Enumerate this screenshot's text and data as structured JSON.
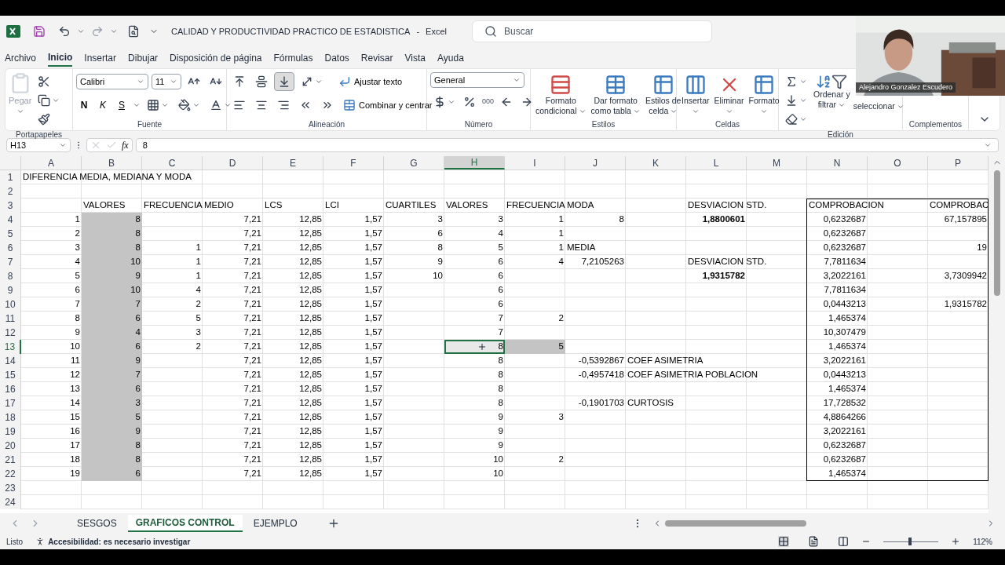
{
  "title_bar": {
    "title": "CALIDAD Y PRODUCTIVIDAD PRACTICO DE ESTADISTICA",
    "app": "Excel",
    "separator": "-",
    "search_placeholder": "Buscar"
  },
  "menu_tabs": [
    {
      "label": "Archivo",
      "selected": false
    },
    {
      "label": "Inicio",
      "selected": true
    },
    {
      "label": "Insertar",
      "selected": false
    },
    {
      "label": "Dibujar",
      "selected": false
    },
    {
      "label": "Disposición de página",
      "selected": false
    },
    {
      "label": "Fórmulas",
      "selected": false
    },
    {
      "label": "Datos",
      "selected": false
    },
    {
      "label": "Revisar",
      "selected": false
    },
    {
      "label": "Vista",
      "selected": false
    },
    {
      "label": "Ayuda",
      "selected": false
    }
  ],
  "ribbon": {
    "clipboard": {
      "label": "Portapapeles",
      "paste": {
        "label": "Pegar",
        "disabled": true
      }
    },
    "font": {
      "label": "Fuente",
      "font_name": "Calibri",
      "font_size": "11",
      "bold": "N",
      "italic": "K",
      "underline": "S"
    },
    "alignment": {
      "label": "Alineación",
      "wrap_text": "Ajustar texto",
      "merge_center": "Combinar y centrar",
      "bottom_align_on": true
    },
    "number": {
      "label": "Número",
      "format": "General",
      "thousands": "000"
    },
    "styles": {
      "label": "Estilos",
      "buttons": [
        {
          "lines": [
            "Formato",
            "condicional"
          ]
        },
        {
          "lines": [
            "Dar formato",
            "como tabla"
          ]
        },
        {
          "lines": [
            "Estilos de",
            "celda"
          ]
        }
      ]
    },
    "cells": {
      "label": "Celdas",
      "buttons": [
        {
          "lines": [
            "Insertar"
          ]
        },
        {
          "lines": [
            "Eliminar"
          ]
        },
        {
          "lines": [
            "Formato"
          ]
        }
      ]
    },
    "editing": {
      "label": "Edición",
      "buttons": [
        {
          "lines": [
            "Ordenar y",
            "filtrar"
          ]
        },
        {
          "lines": [
            "seleccionar"
          ]
        }
      ]
    },
    "addins": {
      "label": "Complementos"
    }
  },
  "formula_bar": {
    "name_box": "H13",
    "function_label": "fx",
    "formula": "8"
  },
  "sheet": {
    "columns": [
      "A",
      "B",
      "C",
      "D",
      "E",
      "F",
      "G",
      "H",
      "I",
      "J",
      "K",
      "L",
      "M",
      "N",
      "O",
      "P"
    ],
    "rows": [
      {
        "number": "1",
        "cells": [
          {
            "text": "DIFERENCIA MEDIA, MEDIANA Y MODA",
            "kind": "text"
          }
        ]
      },
      {
        "number": "2",
        "cells": []
      },
      {
        "number": "3",
        "cells": [
          "",
          {
            "text": "VALORES",
            "kind": "text"
          },
          {
            "text": "FRECUENCIA",
            "kind": "text"
          },
          {
            "text": "MEDIO",
            "kind": "text"
          },
          {
            "text": "LCS",
            "kind": "text"
          },
          {
            "text": "LCI",
            "kind": "text"
          },
          {
            "text": "CUARTILES",
            "kind": "text"
          },
          {
            "text": "VALORES",
            "kind": "text"
          },
          {
            "text": "FRECUENCIA",
            "kind": "text"
          },
          {
            "text": "MODA",
            "kind": "text"
          },
          "",
          {
            "text": "DESVIACION STD.",
            "kind": "text"
          },
          "",
          {
            "text": "COMPROBACION",
            "kind": "text"
          },
          "",
          {
            "text": "COMPROBAC",
            "kind": "text"
          }
        ]
      },
      {
        "number": "4",
        "cells": [
          {
            "text": "1",
            "kind": "number"
          },
          {
            "text": "8",
            "kind": "shaded_number"
          },
          "",
          {
            "text": "7,21",
            "kind": "number"
          },
          {
            "text": "12,85",
            "kind": "number"
          },
          {
            "text": "1,57",
            "kind": "number"
          },
          {
            "text": "3",
            "kind": "number"
          },
          {
            "text": "3",
            "kind": "number"
          },
          {
            "text": "1",
            "kind": "number"
          },
          {
            "text": "8",
            "kind": "number"
          },
          "",
          {
            "text": "1,8800601",
            "kind": "bold_number"
          },
          "",
          {
            "text": "0,6232687",
            "kind": "number"
          },
          "",
          {
            "text": "67,157895",
            "kind": "number"
          }
        ]
      },
      {
        "number": "5",
        "cells": [
          {
            "text": "2",
            "kind": "number"
          },
          {
            "text": "8",
            "kind": "shaded_number"
          },
          "",
          {
            "text": "7,21",
            "kind": "number"
          },
          {
            "text": "12,85",
            "kind": "number"
          },
          {
            "text": "1,57",
            "kind": "number"
          },
          {
            "text": "6",
            "kind": "number"
          },
          {
            "text": "4",
            "kind": "number"
          },
          {
            "text": "1",
            "kind": "number"
          },
          "",
          "",
          "",
          "",
          {
            "text": "0,6232687",
            "kind": "number"
          }
        ]
      },
      {
        "number": "6",
        "cells": [
          {
            "text": "3",
            "kind": "number"
          },
          {
            "text": "8",
            "kind": "shaded_number"
          },
          {
            "text": "1",
            "kind": "number"
          },
          {
            "text": "7,21",
            "kind": "number"
          },
          {
            "text": "12,85",
            "kind": "number"
          },
          {
            "text": "1,57",
            "kind": "number"
          },
          {
            "text": "8",
            "kind": "number"
          },
          {
            "text": "5",
            "kind": "number"
          },
          {
            "text": "1",
            "kind": "number"
          },
          {
            "text": "MEDIA",
            "kind": "text"
          },
          "",
          "",
          "",
          {
            "text": "0,6232687",
            "kind": "number"
          },
          "",
          {
            "text": "19",
            "kind": "number"
          }
        ]
      },
      {
        "number": "7",
        "cells": [
          {
            "text": "4",
            "kind": "number"
          },
          {
            "text": "10",
            "kind": "shaded_number"
          },
          {
            "text": "1",
            "kind": "number"
          },
          {
            "text": "7,21",
            "kind": "number"
          },
          {
            "text": "12,85",
            "kind": "number"
          },
          {
            "text": "1,57",
            "kind": "number"
          },
          {
            "text": "9",
            "kind": "number"
          },
          {
            "text": "6",
            "kind": "number"
          },
          {
            "text": "4",
            "kind": "number"
          },
          {
            "text": "7,2105263",
            "kind": "number"
          },
          "",
          {
            "text": "DESVIACION STD.",
            "kind": "text"
          },
          "",
          {
            "text": "7,7811634",
            "kind": "number"
          }
        ]
      },
      {
        "number": "8",
        "cells": [
          {
            "text": "5",
            "kind": "number"
          },
          {
            "text": "9",
            "kind": "shaded_number"
          },
          {
            "text": "1",
            "kind": "number"
          },
          {
            "text": "7,21",
            "kind": "number"
          },
          {
            "text": "12,85",
            "kind": "number"
          },
          {
            "text": "1,57",
            "kind": "number"
          },
          {
            "text": "10",
            "kind": "number"
          },
          {
            "text": "6",
            "kind": "number"
          },
          "",
          "",
          "",
          {
            "text": "1,9315782",
            "kind": "bold_number"
          },
          "",
          {
            "text": "3,2022161",
            "kind": "number"
          },
          "",
          {
            "text": "3,7309942",
            "kind": "number"
          }
        ]
      },
      {
        "number": "9",
        "cells": [
          {
            "text": "6",
            "kind": "number"
          },
          {
            "text": "10",
            "kind": "shaded_number"
          },
          {
            "text": "4",
            "kind": "number"
          },
          {
            "text": "7,21",
            "kind": "number"
          },
          {
            "text": "12,85",
            "kind": "number"
          },
          {
            "text": "1,57",
            "kind": "number"
          },
          "",
          {
            "text": "6",
            "kind": "number"
          },
          "",
          "",
          "",
          "",
          "",
          {
            "text": "7,7811634",
            "kind": "number"
          }
        ]
      },
      {
        "number": "10",
        "cells": [
          {
            "text": "7",
            "kind": "number"
          },
          {
            "text": "7",
            "kind": "shaded_number"
          },
          {
            "text": "2",
            "kind": "number"
          },
          {
            "text": "7,21",
            "kind": "number"
          },
          {
            "text": "12,85",
            "kind": "number"
          },
          {
            "text": "1,57",
            "kind": "number"
          },
          "",
          {
            "text": "6",
            "kind": "number"
          },
          "",
          "",
          "",
          "",
          "",
          {
            "text": "0,0443213",
            "kind": "number"
          },
          "",
          {
            "text": "1,9315782",
            "kind": "number"
          }
        ]
      },
      {
        "number": "11",
        "cells": [
          {
            "text": "8",
            "kind": "number"
          },
          {
            "text": "6",
            "kind": "shaded_number"
          },
          {
            "text": "5",
            "kind": "number"
          },
          {
            "text": "7,21",
            "kind": "number"
          },
          {
            "text": "12,85",
            "kind": "number"
          },
          {
            "text": "1,57",
            "kind": "number"
          },
          "",
          {
            "text": "7",
            "kind": "number"
          },
          {
            "text": "2",
            "kind": "number"
          },
          "",
          "",
          "",
          "",
          {
            "text": "1,465374",
            "kind": "number"
          }
        ]
      },
      {
        "number": "12",
        "cells": [
          {
            "text": "9",
            "kind": "number"
          },
          {
            "text": "4",
            "kind": "shaded_number"
          },
          {
            "text": "3",
            "kind": "number"
          },
          {
            "text": "7,21",
            "kind": "number"
          },
          {
            "text": "12,85",
            "kind": "number"
          },
          {
            "text": "1,57",
            "kind": "number"
          },
          "",
          {
            "text": "7",
            "kind": "number"
          },
          "",
          "",
          "",
          "",
          "",
          {
            "text": "10,307479",
            "kind": "number"
          }
        ]
      },
      {
        "number": "13",
        "cells": [
          {
            "text": "10",
            "kind": "number"
          },
          {
            "text": "6",
            "kind": "shaded_number"
          },
          {
            "text": "2",
            "kind": "number"
          },
          {
            "text": "7,21",
            "kind": "number"
          },
          {
            "text": "12,85",
            "kind": "number"
          },
          {
            "text": "1,57",
            "kind": "number"
          },
          "",
          {
            "text": "8",
            "kind": "active_number"
          },
          {
            "text": "5",
            "kind": "shaded_number"
          },
          "",
          "",
          "",
          "",
          {
            "text": "1,465374",
            "kind": "number"
          }
        ]
      },
      {
        "number": "14",
        "cells": [
          {
            "text": "11",
            "kind": "number"
          },
          {
            "text": "9",
            "kind": "shaded_number"
          },
          "",
          {
            "text": "7,21",
            "kind": "number"
          },
          {
            "text": "12,85",
            "kind": "number"
          },
          {
            "text": "1,57",
            "kind": "number"
          },
          "",
          {
            "text": "8",
            "kind": "number"
          },
          "",
          {
            "text": "-0,5392867",
            "kind": "number"
          },
          {
            "text": "COEF ASIMETRIA",
            "kind": "text"
          },
          "",
          "",
          {
            "text": "3,2022161",
            "kind": "number"
          }
        ]
      },
      {
        "number": "15",
        "cells": [
          {
            "text": "12",
            "kind": "number"
          },
          {
            "text": "7",
            "kind": "shaded_number"
          },
          "",
          {
            "text": "7,21",
            "kind": "number"
          },
          {
            "text": "12,85",
            "kind": "number"
          },
          {
            "text": "1,57",
            "kind": "number"
          },
          "",
          {
            "text": "8",
            "kind": "number"
          },
          "",
          {
            "text": "-0,4957418",
            "kind": "number"
          },
          {
            "text": "COEF ASIMETRIA POBLACION",
            "kind": "text"
          },
          "",
          "",
          {
            "text": "0,0443213",
            "kind": "number"
          }
        ]
      },
      {
        "number": "16",
        "cells": [
          {
            "text": "13",
            "kind": "number"
          },
          {
            "text": "6",
            "kind": "shaded_number"
          },
          "",
          {
            "text": "7,21",
            "kind": "number"
          },
          {
            "text": "12,85",
            "kind": "number"
          },
          {
            "text": "1,57",
            "kind": "number"
          },
          "",
          {
            "text": "8",
            "kind": "number"
          },
          "",
          "",
          "",
          "",
          "",
          {
            "text": "1,465374",
            "kind": "number"
          }
        ]
      },
      {
        "number": "17",
        "cells": [
          {
            "text": "14",
            "kind": "number"
          },
          {
            "text": "3",
            "kind": "shaded_number"
          },
          "",
          {
            "text": "7,21",
            "kind": "number"
          },
          {
            "text": "12,85",
            "kind": "number"
          },
          {
            "text": "1,57",
            "kind": "number"
          },
          "",
          {
            "text": "8",
            "kind": "number"
          },
          "",
          {
            "text": "-0,1901703",
            "kind": "number"
          },
          {
            "text": "CURTOSIS",
            "kind": "text"
          },
          "",
          "",
          {
            "text": "17,728532",
            "kind": "number"
          }
        ]
      },
      {
        "number": "18",
        "cells": [
          {
            "text": "15",
            "kind": "number"
          },
          {
            "text": "5",
            "kind": "shaded_number"
          },
          "",
          {
            "text": "7,21",
            "kind": "number"
          },
          {
            "text": "12,85",
            "kind": "number"
          },
          {
            "text": "1,57",
            "kind": "number"
          },
          "",
          {
            "text": "9",
            "kind": "number"
          },
          {
            "text": "3",
            "kind": "number"
          },
          "",
          "",
          "",
          "",
          {
            "text": "4,8864266",
            "kind": "number"
          }
        ]
      },
      {
        "number": "19",
        "cells": [
          {
            "text": "16",
            "kind": "number"
          },
          {
            "text": "9",
            "kind": "shaded_number"
          },
          "",
          {
            "text": "7,21",
            "kind": "number"
          },
          {
            "text": "12,85",
            "kind": "number"
          },
          {
            "text": "1,57",
            "kind": "number"
          },
          "",
          {
            "text": "9",
            "kind": "number"
          },
          "",
          "",
          "",
          "",
          "",
          {
            "text": "3,2022161",
            "kind": "number"
          }
        ]
      },
      {
        "number": "20",
        "cells": [
          {
            "text": "17",
            "kind": "number"
          },
          {
            "text": "8",
            "kind": "shaded_number"
          },
          "",
          {
            "text": "7,21",
            "kind": "number"
          },
          {
            "text": "12,85",
            "kind": "number"
          },
          {
            "text": "1,57",
            "kind": "number"
          },
          "",
          {
            "text": "9",
            "kind": "number"
          },
          "",
          "",
          "",
          "",
          "",
          {
            "text": "0,6232687",
            "kind": "number"
          }
        ]
      },
      {
        "number": "21",
        "cells": [
          {
            "text": "18",
            "kind": "number"
          },
          {
            "text": "8",
            "kind": "shaded_number"
          },
          "",
          {
            "text": "7,21",
            "kind": "number"
          },
          {
            "text": "12,85",
            "kind": "number"
          },
          {
            "text": "1,57",
            "kind": "number"
          },
          "",
          {
            "text": "10",
            "kind": "number"
          },
          {
            "text": "2",
            "kind": "number"
          },
          "",
          "",
          "",
          "",
          {
            "text": "0,6232687",
            "kind": "number"
          }
        ]
      },
      {
        "number": "22",
        "cells": [
          {
            "text": "19",
            "kind": "number"
          },
          {
            "text": "6",
            "kind": "shaded_number"
          },
          "",
          {
            "text": "7,21",
            "kind": "number"
          },
          {
            "text": "12,85",
            "kind": "number"
          },
          {
            "text": "1,57",
            "kind": "number"
          },
          "",
          {
            "text": "10",
            "kind": "number"
          },
          "",
          "",
          "",
          "",
          "",
          {
            "text": "1,465374",
            "kind": "number"
          }
        ]
      },
      {
        "number": "23",
        "cells": []
      },
      {
        "number": "24",
        "cells": []
      }
    ]
  },
  "sheet_tabs": [
    {
      "label": "SESGOS",
      "selected": false
    },
    {
      "label": "GRAFICOS CONTROL",
      "selected": true
    },
    {
      "label": "EJEMPLO",
      "selected": false
    }
  ],
  "status_bar": {
    "status": "Listo",
    "accessibility": "Accesibilidad: es necesario investigar",
    "zoom": {
      "level": 0.48,
      "reading": "112%"
    }
  },
  "video_overlay": {
    "name": "Alejandro Gonzalez Escudero"
  }
}
